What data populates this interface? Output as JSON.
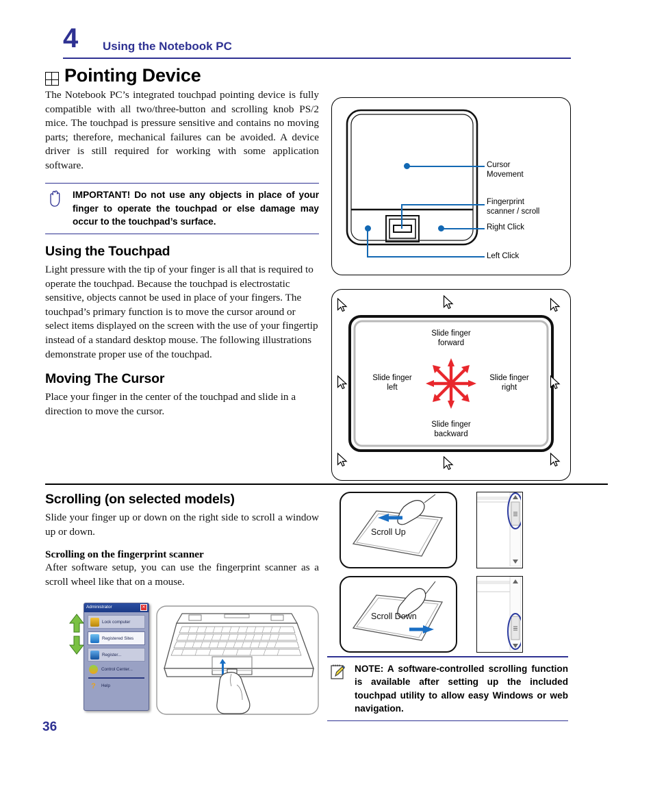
{
  "header": {
    "chapter_number": "4",
    "title": "Using the Notebook PC"
  },
  "page_number": "36",
  "main_heading": "Pointing Device",
  "intro_paragraph": "The Notebook PC’s integrated touchpad pointing device is fully compatible with all two/three-button and scrolling knob PS/2 mice. The touchpad is pressure sensitive and contains no moving parts; therefore, mechanical failures can be avoided. A device driver is still required for working with some application software.",
  "important_note": {
    "icon": "hand-stop-icon",
    "text": "IMPORTANT! Do not use any objects in place of your finger to operate the touchpad or else damage may occur to the touchpad’s surface."
  },
  "sections": {
    "using_touchpad": {
      "heading": "Using the Touchpad",
      "body": "Light pressure with the tip of your finger is all that is required to operate the touchpad. Because the touchpad is electrostatic sensitive, objects cannot be used in place of your fingers. The touchpad’s primary function is to move the cursor around or select items displayed on the screen with the use of your fingertip instead of a standard desktop mouse. The following illustrations demonstrate proper use of the touchpad."
    },
    "moving_cursor": {
      "heading": "Moving The Cursor",
      "body": "Place your finger in the center of the touchpad and slide in a direction to move the cursor."
    },
    "scrolling": {
      "heading": "Scrolling (on selected models)",
      "body": "Slide your finger up or down on the right side to scroll a window up or down.",
      "sub_heading": "Scrolling on the fingerprint scanner",
      "sub_body": "After software setup, you can use the fingerprint scanner as a scroll wheel like that on a mouse."
    }
  },
  "figures": {
    "touchpad_parts": {
      "name": "touchpad-component-diagram",
      "labels": [
        "Cursor\nMovement",
        "Fingerprint\nscanner / scroll",
        "Right Click",
        "Left Click"
      ],
      "label_cursor_movement_line1": "Cursor",
      "label_cursor_movement_line2": "Movement",
      "label_fingerprint_line1": "Fingerprint",
      "label_fingerprint_line2": "scanner / scroll",
      "label_right_click": "Right Click",
      "label_left_click": "Left Click",
      "leader_color": "#1268b3"
    },
    "slide_finger": {
      "name": "slide-finger-direction-diagram",
      "forward_line1": "Slide finger",
      "forward_line2": "forward",
      "backward_line1": "Slide finger",
      "backward_line2": "backward",
      "left_line1": "Slide finger",
      "left_line2": "left",
      "right_line1": "Slide finger",
      "right_line2": "right",
      "arrow_color": "#e8272c",
      "cursor_count": 8
    },
    "scroll_up": {
      "name": "scroll-up-figure",
      "label": "Scroll Up",
      "arrow_color": "#1a6fc4",
      "highlight_color": "#2b3a9e"
    },
    "scroll_down": {
      "name": "scroll-down-figure",
      "label": "Scroll Down",
      "arrow_color": "#1a6fc4",
      "highlight_color": "#2b3a9e"
    },
    "fingerprint_menu_screenshot": {
      "name": "fingerprint-software-menu",
      "title": "Administrator",
      "items": [
        {
          "label": "Lock computer",
          "icon": "lock-icon",
          "selected": false
        },
        {
          "label": "Registered Sites",
          "icon": "sites-icon",
          "selected": true
        },
        {
          "label": "Register...",
          "icon": "register-icon",
          "selected": false
        },
        {
          "label": "Control Center...",
          "icon": "control-center-icon",
          "selected": false
        },
        {
          "label": "Help",
          "icon": "question-mark-icon",
          "selected": false
        }
      ],
      "close_button": "✕",
      "arrow_icon": "green-up-down-arrow"
    },
    "notebook_illustration": {
      "name": "notebook-fingerprint-scroll-illustration",
      "arrow_icon": "blue-up-down-arrow"
    }
  },
  "bottom_note": {
    "icon": "note-pad-icon",
    "text": "NOTE: A software-controlled scrolling function is available after setting up the included touchpad utility to allow easy Windows or web navigation."
  },
  "colors": {
    "accent_blue": "#2e3192",
    "leader_blue": "#1268b3",
    "arrow_red": "#e8272c",
    "arrow_green": "#7ac143"
  }
}
